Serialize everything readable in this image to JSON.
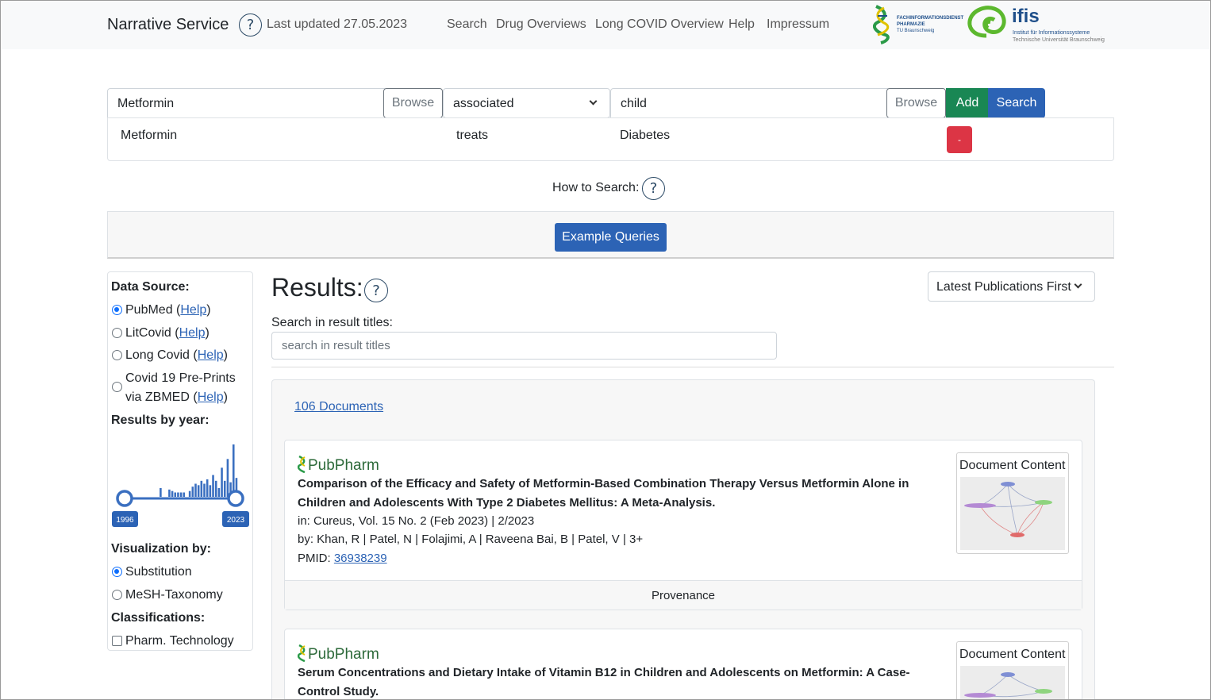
{
  "header": {
    "brand": "Narrative Service",
    "last_updated": "Last updated 27.05.2023",
    "nav": [
      "Search",
      "Drug Overviews",
      "Long COVID Overview",
      "Help",
      "Impressum"
    ],
    "logo_left": {
      "line1": "FACHINFORMATIONSDIENST",
      "line2": "PHARMAZIE",
      "line3": "TU Braunschweig"
    },
    "logo_right": {
      "name": "ifis",
      "line1": "Institut für Informationssysteme",
      "line2": "Technische Universität Braunschweig"
    }
  },
  "query": {
    "subject_value": "Metformin",
    "browse_label": "Browse",
    "relation_value": "associated",
    "object_value": "child",
    "add_label": "Add",
    "search_label": "Search",
    "fact": {
      "subject": "Metformin",
      "relation": "treats",
      "object": "Diabetes",
      "remove_label": "-"
    }
  },
  "how_to_search": "How to Search:",
  "example_queries": "Example Queries",
  "sidebar": {
    "data_source_heading": "Data Source:",
    "sources": [
      {
        "name": "PubMed",
        "help": "Help",
        "selected": true
      },
      {
        "name": "LitCovid",
        "help": "Help",
        "selected": false
      },
      {
        "name": "Long Covid",
        "help": "Help",
        "selected": false
      },
      {
        "line1": "Covid 19 Pre-Prints",
        "line2": "via ZBMED",
        "help": "Help",
        "selected": false
      }
    ],
    "results_by_year_heading": "Results by year:",
    "year_range": {
      "from": "1996",
      "to": "2023"
    },
    "visualization_heading": "Visualization by:",
    "visualizations": [
      {
        "name": "Substitution",
        "selected": true
      },
      {
        "name": "MeSH-Taxonomy",
        "selected": false
      }
    ],
    "classifications_heading": "Classifications:",
    "classifications": [
      {
        "name": "Pharm. Technology",
        "checked": false
      }
    ]
  },
  "chart_data": {
    "type": "bar",
    "values": [
      3,
      0,
      0,
      0,
      0,
      0,
      0,
      0,
      0,
      0,
      0,
      0,
      6,
      0,
      0,
      5,
      4,
      3,
      3,
      3,
      3,
      0,
      4,
      7,
      9,
      8,
      11,
      9,
      12,
      8,
      15,
      11,
      6,
      20,
      11,
      26,
      10,
      36,
      13,
      4
    ]
  },
  "results": {
    "title": "Results:",
    "sort": "Latest Publications First",
    "search_label": "Search in result titles:",
    "search_placeholder": "search in result titles",
    "document_count": "106 Documents",
    "source_logo": "PubPharm",
    "content_label": "Document Content",
    "provenance_label": "Provenance",
    "documents": [
      {
        "title": "Comparison of the Efficacy and Safety of Metformin-Based Combination Therapy Versus Metformin Alone in Children and Adolescents With Type 2 Diabetes Mellitus: A Meta-Analysis.",
        "journal": "in: Cureus, Vol. 15 No. 2 (Feb 2023) | 2/2023",
        "authors": "by: Khan, R | Patel, N | Folajimi, A | Raveena Bai, B | Patel, V | 3+",
        "pmid_label": "PMID:",
        "pmid": "36938239"
      },
      {
        "title": "Serum Concentrations and Dietary Intake of Vitamin B12 in Children and Adolescents on Metformin: A Case-Control Study."
      }
    ]
  },
  "colors": {
    "primary": "#2c63b5",
    "add": "#198754",
    "remove": "#dc3545",
    "help_icon": "#2c4a66"
  }
}
